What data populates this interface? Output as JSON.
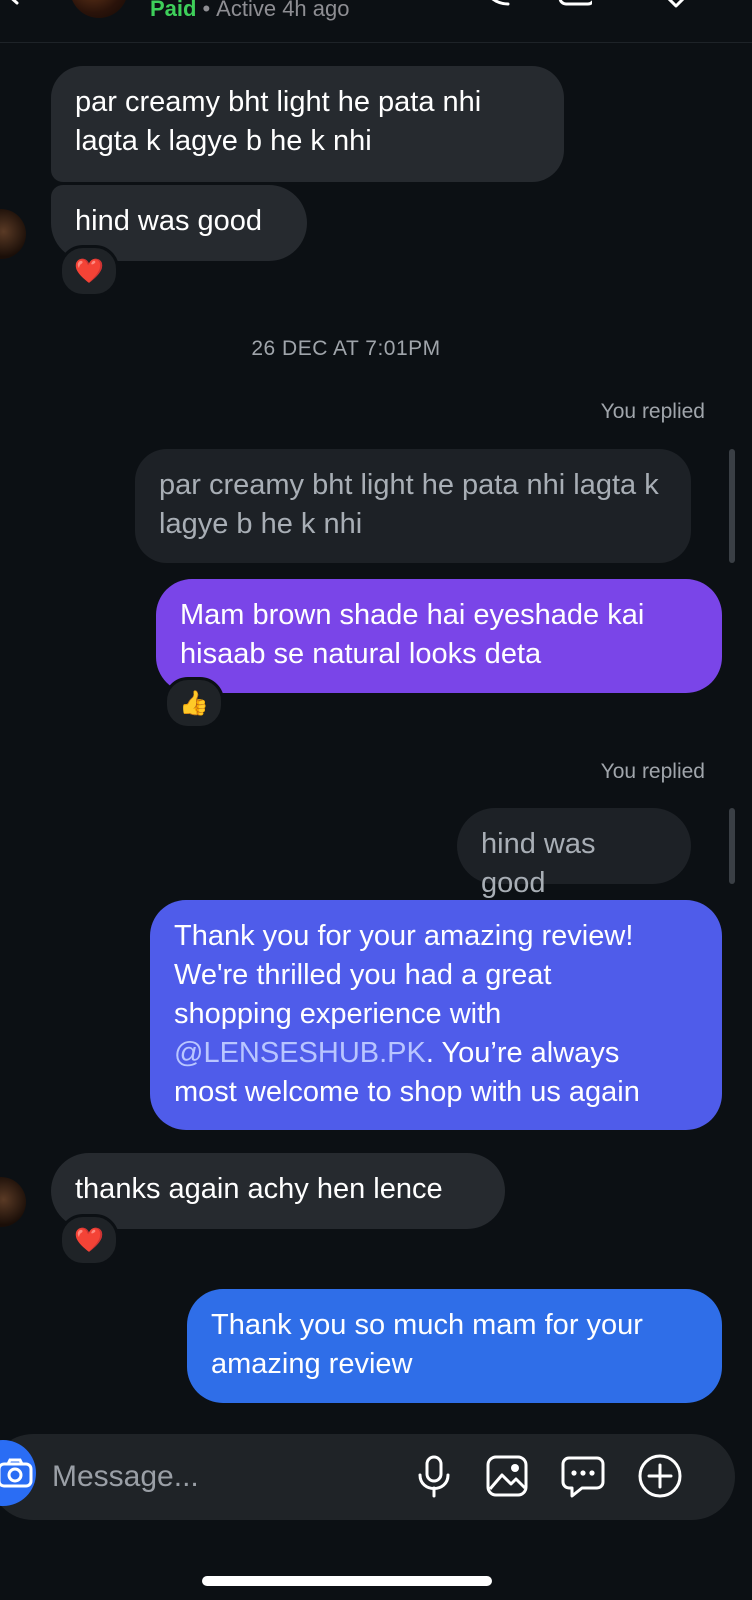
{
  "header": {
    "status_label": "Paid",
    "separator": "•",
    "active_text": "Active 4h ago"
  },
  "messages": [
    {
      "type": "received",
      "text_lines": [
        "par creamy bht light he pata nhi",
        "lagta k lagye b he k nhi"
      ]
    },
    {
      "type": "received",
      "text": "hind was good",
      "reaction": "❤️"
    },
    {
      "type": "date_separator",
      "text": "26 DEC AT 7:01PM"
    },
    {
      "type": "sent_reply",
      "reply_label": "You replied",
      "quoted_lines": [
        "par creamy bht light he pata nhi lagta k",
        "lagye b he k nhi"
      ],
      "text_lines": [
        "Mam brown shade hai eyeshade kai",
        "hisaab se natural looks deta"
      ],
      "reaction": "👍"
    },
    {
      "type": "sent_reply",
      "reply_label": "You replied",
      "quoted": "hind was good",
      "text_lines": [
        "Thank you for your amazing review!",
        "We're thrilled you had a great",
        "shopping experience with"
      ],
      "mention": "@LENSESHUB.PK",
      "after_mention": ". You’re always",
      "last_line": "most welcome to shop with us again"
    },
    {
      "type": "received",
      "text": "thanks again achy hen lence",
      "reaction": "❤️"
    },
    {
      "type": "sent",
      "text_lines": [
        "Thank you so much mam for your",
        "amazing review"
      ]
    }
  ],
  "composer": {
    "placeholder": "Message..."
  },
  "icons": {
    "back": "chevron-left-icon",
    "camera": "camera-icon",
    "mic": "microphone-icon",
    "gallery": "image-icon",
    "sticker": "chat-bubble-icon",
    "more": "plus-circle-icon"
  },
  "colors": {
    "background": "#0c1014",
    "received_bubble": "#262a2f",
    "quoted_bubble": "#1d2126",
    "paid_green": "#3ecf5a",
    "sent_purple": "#7a45e8",
    "sent_indigo": "#4f5cea",
    "sent_blue": "#2f6ee8",
    "camera_button": "#2a6df4"
  }
}
